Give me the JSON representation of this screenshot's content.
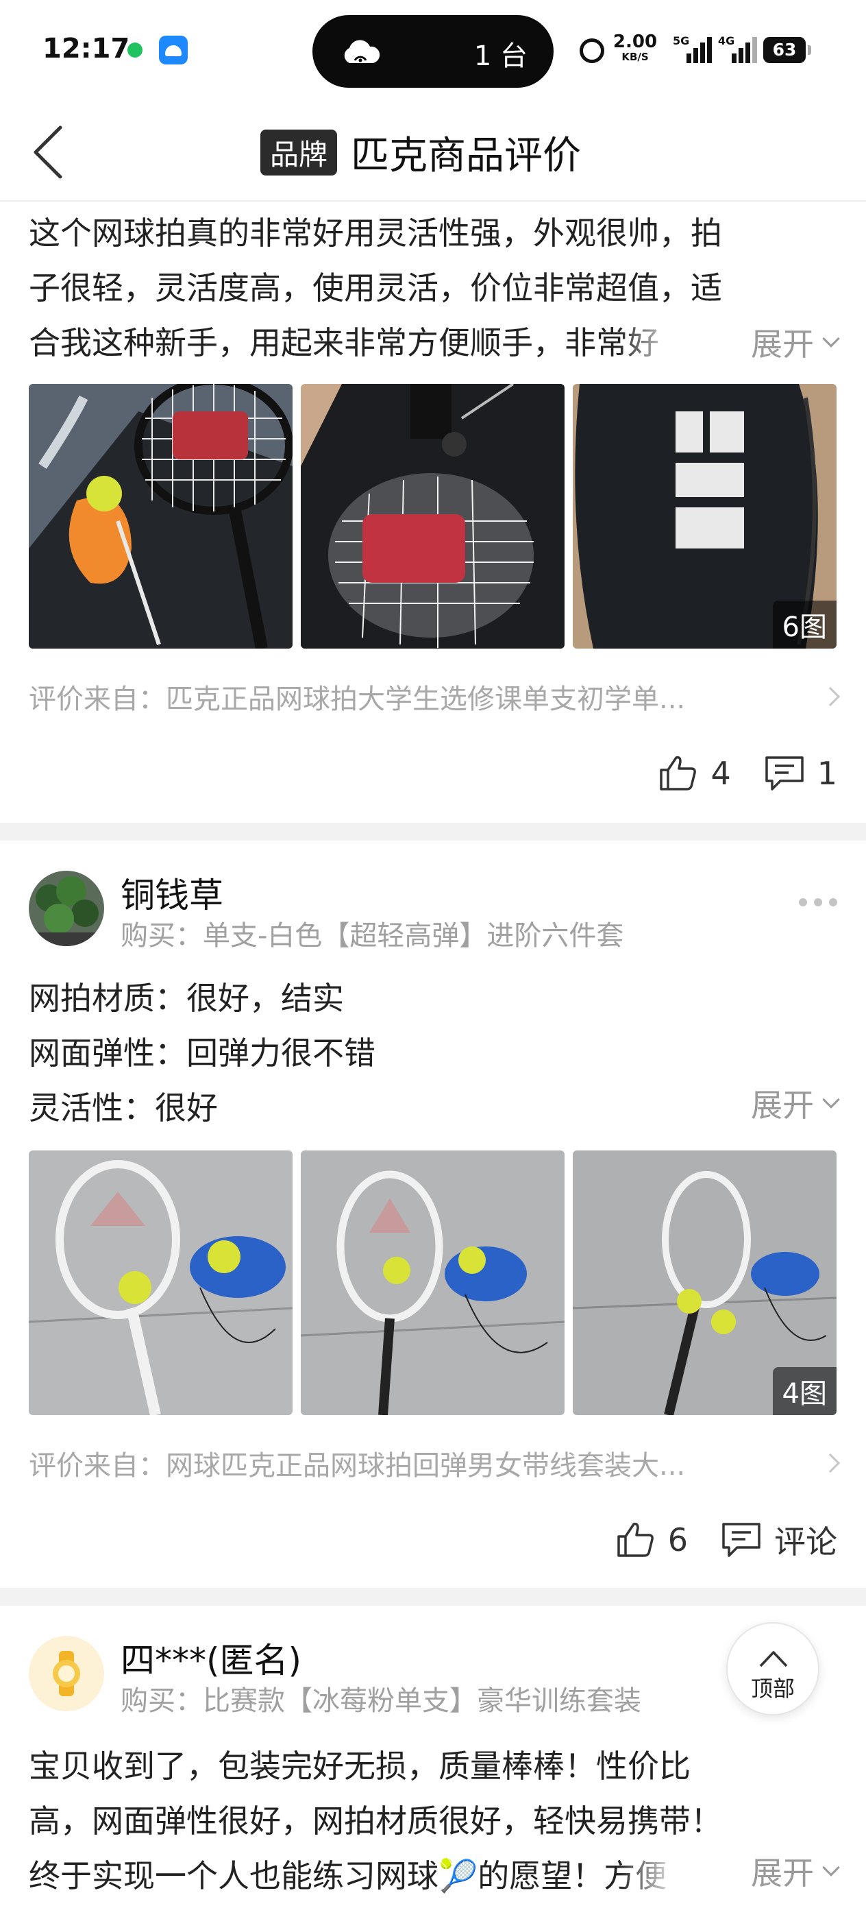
{
  "status_bar": {
    "time": "12:17",
    "island_text": "1 台",
    "net_speed_value": "2.00",
    "net_speed_unit": "KB/S",
    "signal1_label": "5G",
    "signal2_label": "4G",
    "battery": "63"
  },
  "header": {
    "brand_badge": "品牌",
    "title": "匹克商品评价"
  },
  "reviews": [
    {
      "text_lines": [
        "这个网球拍真的非常好用灵活性强，外观很帅，拍",
        "子很轻，灵活度高，使用灵活，价位非常超值，适",
        "合我这种新手，用起来非常方便顺手，非常好"
      ],
      "expand_label": "展开",
      "photo_count": "6图",
      "source": "评价来自：匹克正品网球拍大学生选修课单支初学单...",
      "likes": "4",
      "comments": "1"
    },
    {
      "user": "铜钱草",
      "purchase": "购买：单支-白色【超轻高弹】进阶六件套",
      "text_lines": [
        "网拍材质：很好，结实",
        "网面弹性：回弹力很不错",
        "灵活性：很好"
      ],
      "expand_label": "展开",
      "photo_count": "4图",
      "source": "评价来自：网球匹克正品网球拍回弹男女带线套装大...",
      "likes": "6",
      "comments": "评论"
    },
    {
      "user": "四***(匿名)",
      "purchase": "购买：比赛款【冰莓粉单支】豪华训练套装",
      "text_lines": [
        "宝贝收到了，包装完好无损，质量棒棒！性价比",
        "高，网面弹性很好，网拍材质很好，轻快易携带！",
        "终于实现一个人也能练习网球🎾的愿望！方便"
      ],
      "expand_label": "展开"
    }
  ],
  "top_button": "顶部",
  "colors": {
    "accent_text": "#222222",
    "muted_text": "#a0a0a0",
    "separator": "#f2f2f2",
    "badge_bg": "#2b2b2b"
  }
}
